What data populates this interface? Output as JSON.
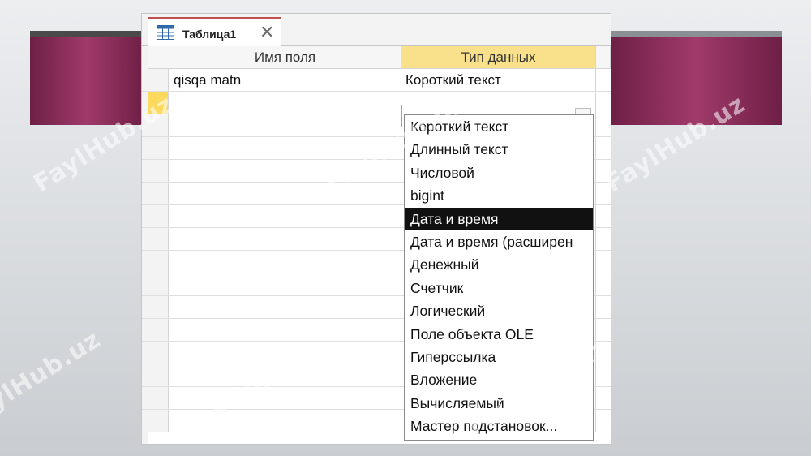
{
  "tab": {
    "title": "Таблица1",
    "icon": "table-icon"
  },
  "columns": {
    "field_name": "Имя поля",
    "data_type": "Тип данных"
  },
  "rows": [
    {
      "field_name": "qisqa matn",
      "data_type": "Короткий текст"
    },
    {
      "field_name": "",
      "data_type": ""
    }
  ],
  "dropdown": {
    "selected_index": 4,
    "options": [
      "Короткий текст",
      "Длинный текст",
      "Числовой",
      "bigint",
      "Дата и время",
      "Дата и время (расширен",
      "Денежный",
      "Счетчик",
      "Логический",
      "Поле объекта OLE",
      "Гиперссылка",
      "Вложение",
      "Вычисляемый",
      "Мастер подстановок..."
    ]
  },
  "watermark": "FaylHub.uz",
  "colors": {
    "header_highlight": "#f9e08a",
    "row_selector_active": "#fbd95c",
    "tab_accent": "#c0504d",
    "band": "#8a2c5a"
  }
}
